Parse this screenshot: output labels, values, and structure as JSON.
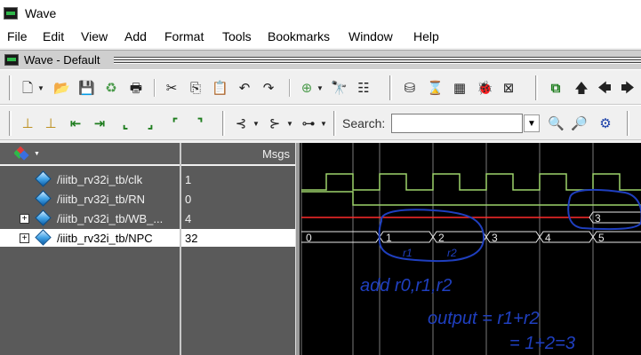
{
  "window": {
    "title": "Wave"
  },
  "menu": [
    "File",
    "Edit",
    "View",
    "Add",
    "Format",
    "Tools",
    "Bookmarks",
    "Window",
    "Help"
  ],
  "pane": {
    "title": "Wave - Default"
  },
  "toolbar": {
    "search_label": "Search:",
    "search_value": ""
  },
  "header": {
    "msgs_label": "Msgs"
  },
  "signals": [
    {
      "name": "/iiitb_rv32i_tb/clk",
      "value": "1",
      "expandable": false
    },
    {
      "name": "/iiitb_rv32i_tb/RN",
      "value": "0",
      "expandable": false
    },
    {
      "name": "/iiitb_rv32i_tb/WB_...",
      "value": "4",
      "expandable": true
    },
    {
      "name": "/iiitb_rv32i_tb/NPC",
      "value": "32",
      "expandable": true
    }
  ],
  "waveform": {
    "wb_out_value": "3",
    "npc_values": [
      "0",
      "1",
      "2",
      "3",
      "4",
      "5"
    ]
  },
  "annotations": {
    "r1": "r1",
    "r2": "r2",
    "instr": "add r0,r1,r2",
    "output_line1": "output = r1+r2",
    "output_line2": "= 1+2=3"
  },
  "colors": {
    "clk": "#9dd36b",
    "rn": "#9dd36b",
    "wb": "#ff2a2a",
    "npc": "#e8e8e8",
    "ink": "#1f3fbf"
  }
}
